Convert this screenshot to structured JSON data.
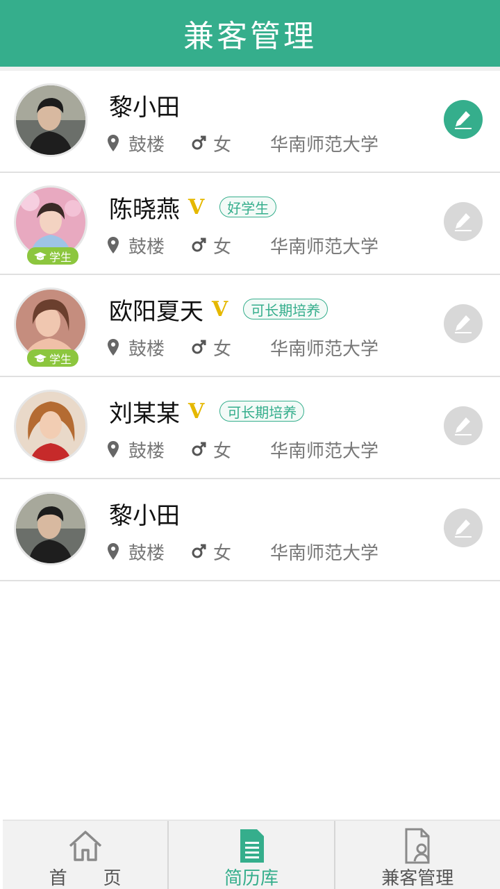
{
  "header": {
    "title": "兼客管理"
  },
  "rows": [
    {
      "name": "黎小田",
      "location": "鼓楼",
      "gender": "女",
      "school": "华南师范大学",
      "vip": "",
      "tag": "",
      "badge": ""
    },
    {
      "name": "陈晓燕",
      "location": "鼓楼",
      "gender": "女",
      "school": "华南师范大学",
      "vip": "V",
      "tag": "好学生",
      "badge": "学生"
    },
    {
      "name": "欧阳夏天",
      "location": "鼓楼",
      "gender": "女",
      "school": "华南师范大学",
      "vip": "V",
      "tag": "可长期培养",
      "badge": "学生"
    },
    {
      "name": "刘某某",
      "location": "鼓楼",
      "gender": "女",
      "school": "华南师范大学",
      "vip": "V",
      "tag": "可长期培养",
      "badge": ""
    },
    {
      "name": "黎小田",
      "location": "鼓楼",
      "gender": "女",
      "school": "华南师范大学",
      "vip": "",
      "tag": "",
      "badge": ""
    }
  ],
  "tabbar": {
    "home": "首　　页",
    "resume": "简历库",
    "manage": "兼客管理"
  },
  "colors": {
    "accent": "#35ae8c",
    "vip": "#e5b800",
    "badge": "#8cc63e"
  }
}
